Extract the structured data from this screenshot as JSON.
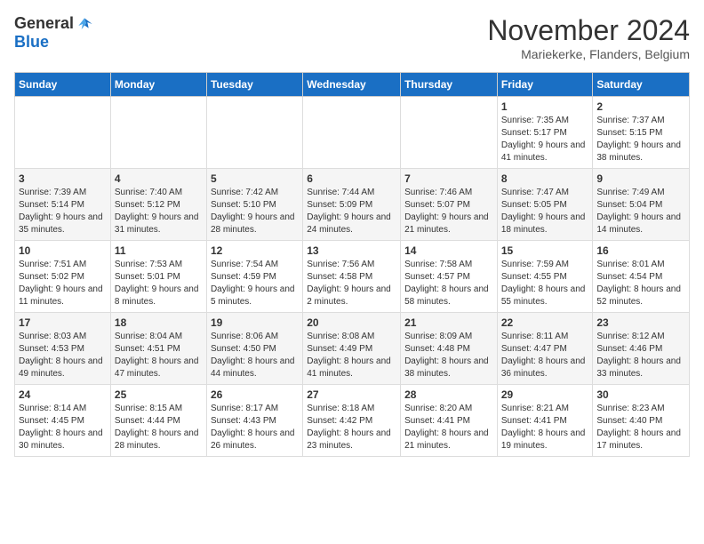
{
  "header": {
    "logo_general": "General",
    "logo_blue": "Blue",
    "month_title": "November 2024",
    "subtitle": "Mariekerke, Flanders, Belgium"
  },
  "weekdays": [
    "Sunday",
    "Monday",
    "Tuesday",
    "Wednesday",
    "Thursday",
    "Friday",
    "Saturday"
  ],
  "weeks": [
    [
      {
        "day": "",
        "info": ""
      },
      {
        "day": "",
        "info": ""
      },
      {
        "day": "",
        "info": ""
      },
      {
        "day": "",
        "info": ""
      },
      {
        "day": "",
        "info": ""
      },
      {
        "day": "1",
        "info": "Sunrise: 7:35 AM\nSunset: 5:17 PM\nDaylight: 9 hours and 41 minutes."
      },
      {
        "day": "2",
        "info": "Sunrise: 7:37 AM\nSunset: 5:15 PM\nDaylight: 9 hours and 38 minutes."
      }
    ],
    [
      {
        "day": "3",
        "info": "Sunrise: 7:39 AM\nSunset: 5:14 PM\nDaylight: 9 hours and 35 minutes."
      },
      {
        "day": "4",
        "info": "Sunrise: 7:40 AM\nSunset: 5:12 PM\nDaylight: 9 hours and 31 minutes."
      },
      {
        "day": "5",
        "info": "Sunrise: 7:42 AM\nSunset: 5:10 PM\nDaylight: 9 hours and 28 minutes."
      },
      {
        "day": "6",
        "info": "Sunrise: 7:44 AM\nSunset: 5:09 PM\nDaylight: 9 hours and 24 minutes."
      },
      {
        "day": "7",
        "info": "Sunrise: 7:46 AM\nSunset: 5:07 PM\nDaylight: 9 hours and 21 minutes."
      },
      {
        "day": "8",
        "info": "Sunrise: 7:47 AM\nSunset: 5:05 PM\nDaylight: 9 hours and 18 minutes."
      },
      {
        "day": "9",
        "info": "Sunrise: 7:49 AM\nSunset: 5:04 PM\nDaylight: 9 hours and 14 minutes."
      }
    ],
    [
      {
        "day": "10",
        "info": "Sunrise: 7:51 AM\nSunset: 5:02 PM\nDaylight: 9 hours and 11 minutes."
      },
      {
        "day": "11",
        "info": "Sunrise: 7:53 AM\nSunset: 5:01 PM\nDaylight: 9 hours and 8 minutes."
      },
      {
        "day": "12",
        "info": "Sunrise: 7:54 AM\nSunset: 4:59 PM\nDaylight: 9 hours and 5 minutes."
      },
      {
        "day": "13",
        "info": "Sunrise: 7:56 AM\nSunset: 4:58 PM\nDaylight: 9 hours and 2 minutes."
      },
      {
        "day": "14",
        "info": "Sunrise: 7:58 AM\nSunset: 4:57 PM\nDaylight: 8 hours and 58 minutes."
      },
      {
        "day": "15",
        "info": "Sunrise: 7:59 AM\nSunset: 4:55 PM\nDaylight: 8 hours and 55 minutes."
      },
      {
        "day": "16",
        "info": "Sunrise: 8:01 AM\nSunset: 4:54 PM\nDaylight: 8 hours and 52 minutes."
      }
    ],
    [
      {
        "day": "17",
        "info": "Sunrise: 8:03 AM\nSunset: 4:53 PM\nDaylight: 8 hours and 49 minutes."
      },
      {
        "day": "18",
        "info": "Sunrise: 8:04 AM\nSunset: 4:51 PM\nDaylight: 8 hours and 47 minutes."
      },
      {
        "day": "19",
        "info": "Sunrise: 8:06 AM\nSunset: 4:50 PM\nDaylight: 8 hours and 44 minutes."
      },
      {
        "day": "20",
        "info": "Sunrise: 8:08 AM\nSunset: 4:49 PM\nDaylight: 8 hours and 41 minutes."
      },
      {
        "day": "21",
        "info": "Sunrise: 8:09 AM\nSunset: 4:48 PM\nDaylight: 8 hours and 38 minutes."
      },
      {
        "day": "22",
        "info": "Sunrise: 8:11 AM\nSunset: 4:47 PM\nDaylight: 8 hours and 36 minutes."
      },
      {
        "day": "23",
        "info": "Sunrise: 8:12 AM\nSunset: 4:46 PM\nDaylight: 8 hours and 33 minutes."
      }
    ],
    [
      {
        "day": "24",
        "info": "Sunrise: 8:14 AM\nSunset: 4:45 PM\nDaylight: 8 hours and 30 minutes."
      },
      {
        "day": "25",
        "info": "Sunrise: 8:15 AM\nSunset: 4:44 PM\nDaylight: 8 hours and 28 minutes."
      },
      {
        "day": "26",
        "info": "Sunrise: 8:17 AM\nSunset: 4:43 PM\nDaylight: 8 hours and 26 minutes."
      },
      {
        "day": "27",
        "info": "Sunrise: 8:18 AM\nSunset: 4:42 PM\nDaylight: 8 hours and 23 minutes."
      },
      {
        "day": "28",
        "info": "Sunrise: 8:20 AM\nSunset: 4:41 PM\nDaylight: 8 hours and 21 minutes."
      },
      {
        "day": "29",
        "info": "Sunrise: 8:21 AM\nSunset: 4:41 PM\nDaylight: 8 hours and 19 minutes."
      },
      {
        "day": "30",
        "info": "Sunrise: 8:23 AM\nSunset: 4:40 PM\nDaylight: 8 hours and 17 minutes."
      }
    ]
  ]
}
